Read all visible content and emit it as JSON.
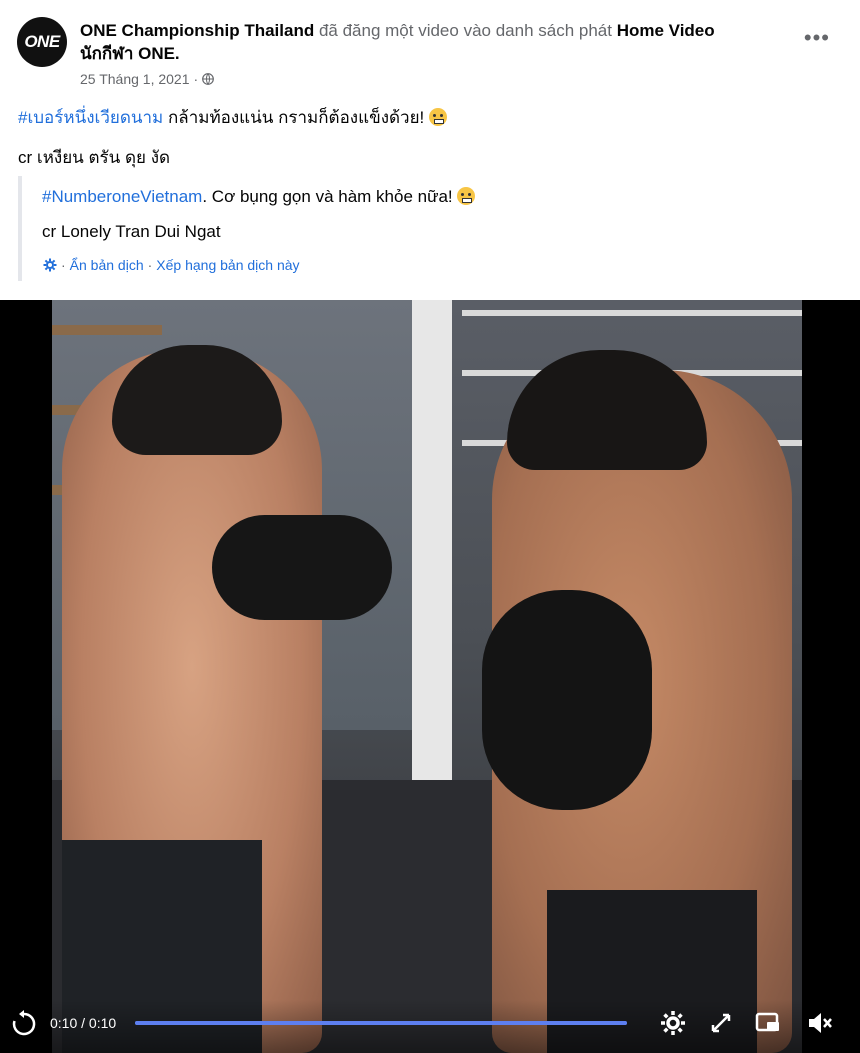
{
  "post": {
    "author": "ONE Championship Thailand",
    "action": "đã đăng một video vào danh sách phát",
    "playlist_line1": "Home Video",
    "playlist_line2": "นักกีฬา ONE.",
    "date": "25 Tháng 1, 2021",
    "avatar_text": "ONE",
    "more_label": "•••",
    "hashtag": "#เบอร์หนึ่งเวียดนาม",
    "line1_text": " กล้ามท้องแน่น กรามก็ต้องแข็งด้วย!",
    "line2_text": "cr เหงียน ตรัน ดุย งัด",
    "quote_hashtag": "#NumberoneVietnam",
    "quote_line1_text": ". Cơ bụng gọn và hàm khỏe nữa!",
    "quote_line2_text": "cr Lonely Tran Dui Ngat",
    "hide_translation": "Ẩn bản dịch",
    "separator": "·",
    "rate_translation": "Xếp hạng bản dịch này"
  },
  "video": {
    "time": "0:10 / 0:10",
    "progress_percent": 100
  },
  "icons": {
    "avatar": "one-logo-icon",
    "globe": "globe-icon",
    "more": "more-options-icon",
    "emoji": "grimacing-face-icon",
    "gear": "gear-icon",
    "replay": "replay-icon",
    "settings": "settings-icon",
    "expand": "expand-icon",
    "pip": "picture-in-picture-icon",
    "mute": "volume-muted-icon"
  }
}
